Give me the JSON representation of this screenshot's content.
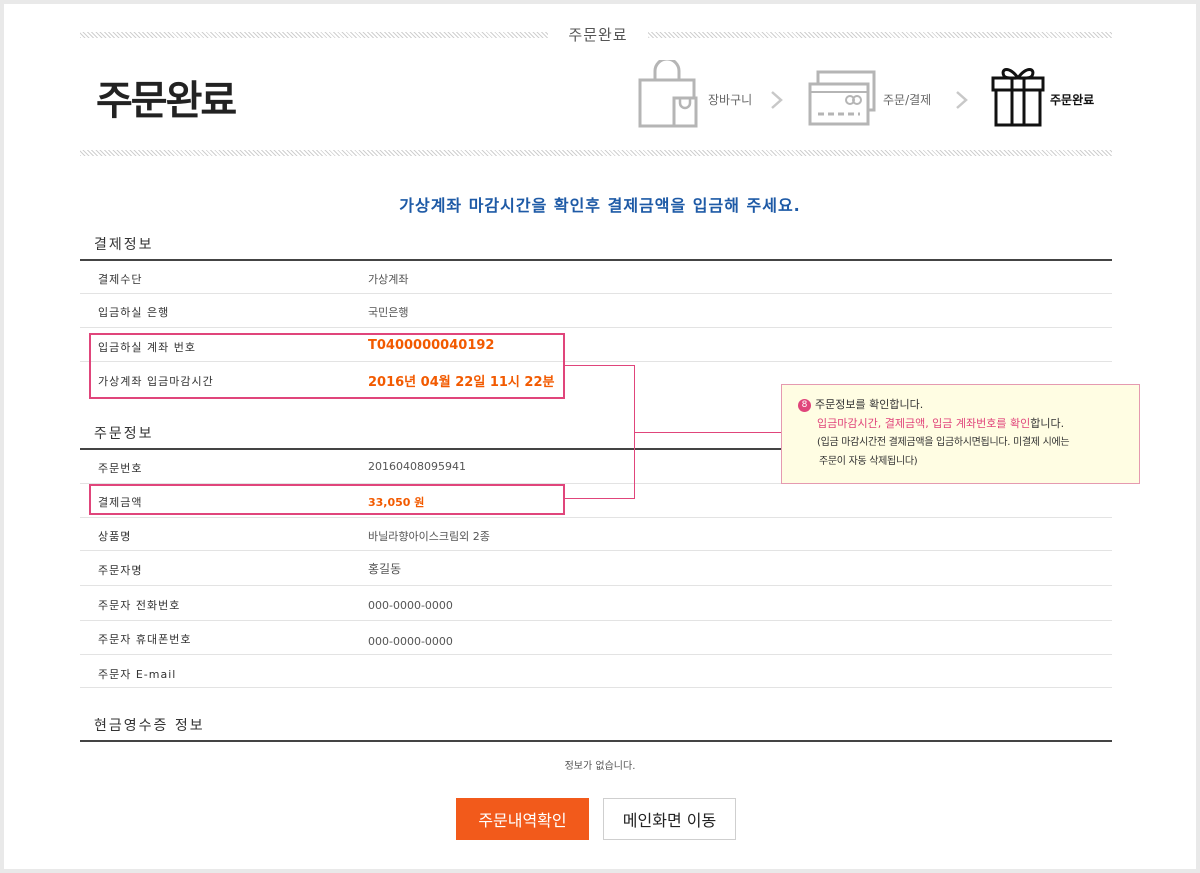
{
  "header": {
    "caption": "주문완료",
    "title": "주문완료",
    "steps": [
      {
        "label": "장바구니",
        "icon": "shopping-bag-icon",
        "active": false
      },
      {
        "label": "주문/결제",
        "icon": "credit-card-icon",
        "active": false
      },
      {
        "label": "주문완료",
        "icon": "gift-icon",
        "active": true
      }
    ]
  },
  "notice": "가상계좌 마감시간을 확인후 결제금액을 입금해 주세요.",
  "payment_info": {
    "title": "결제정보",
    "rows": [
      {
        "label": "결제수단",
        "value": "가상계좌"
      },
      {
        "label": "입금하실 은행",
        "value": "국민은행"
      },
      {
        "label": "입금하실 계좌 번호",
        "value": "T0400000040192"
      },
      {
        "label": "가상계좌 입금마감시간",
        "value": "2016년 04월 22일 11시 22분"
      }
    ]
  },
  "order_info": {
    "title": "주문정보",
    "rows": [
      {
        "label": "주문번호",
        "value": "20160408095941"
      },
      {
        "label": "결제금액",
        "value": "33,050 원"
      },
      {
        "label": "상품명",
        "value": "바닐라향아이스크림외 2종"
      },
      {
        "label": "주문자명",
        "value": "홍길동"
      },
      {
        "label": "주문자 전화번호",
        "value": "000-0000-0000"
      },
      {
        "label": "주문자 휴대폰번호",
        "value": "000-0000-0000"
      },
      {
        "label": "주문자 E-mail",
        "value": ""
      }
    ]
  },
  "cash_receipt": {
    "title": "현금영수증 정보",
    "empty_text": "정보가 없습니다."
  },
  "tooltip": {
    "badge": "8",
    "line1": "주문정보를 확인합니다.",
    "line2_pink": "입금마감시간, 결제금액, 입금 계좌번호를 확인",
    "line2_rest": "합니다.",
    "line3": "(입금 마감시간전 결제금액을 입금하시면됩니다. 미결제 시에는",
    "line4": "주문이 자동 삭제됩니다)"
  },
  "buttons": {
    "order_history": "주문내역확인",
    "go_main": "메인화면 이동"
  },
  "colors": {
    "accent_orange": "#f25a1b",
    "highlight_pink": "#e0457b",
    "notice_blue": "#1e5aa6"
  }
}
